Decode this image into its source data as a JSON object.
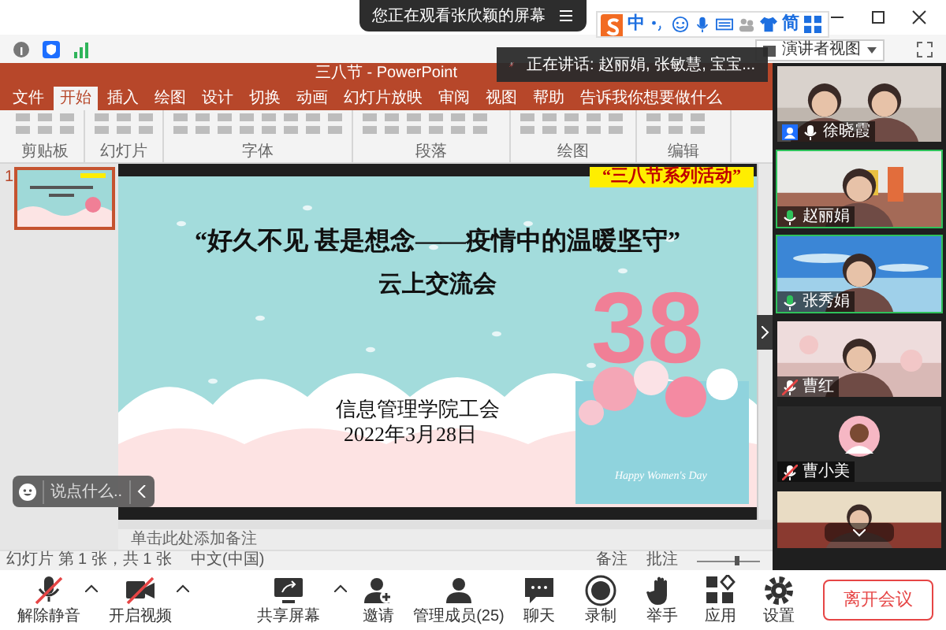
{
  "meeting_banner": {
    "text": "您正在观看张欣颖的屏幕"
  },
  "view_menu": {
    "label": "演讲者视图"
  },
  "ime_toolbar": {
    "items": [
      "中",
      "简"
    ]
  },
  "speaking_banner": {
    "text": "正在讲话: 赵丽娟, 张敏慧, 宝宝..."
  },
  "ppt": {
    "title": "三八节 - PowerPoint",
    "ribbon_tabs": [
      {
        "label": "文件",
        "selected": false
      },
      {
        "label": "开始",
        "selected": true
      },
      {
        "label": "插入",
        "selected": false
      },
      {
        "label": "绘图",
        "selected": false
      },
      {
        "label": "设计",
        "selected": false
      },
      {
        "label": "切换",
        "selected": false
      },
      {
        "label": "动画",
        "selected": false
      },
      {
        "label": "幻灯片放映",
        "selected": false
      },
      {
        "label": "审阅",
        "selected": false
      },
      {
        "label": "视图",
        "selected": false
      },
      {
        "label": "帮助",
        "selected": false
      },
      {
        "label": "告诉我你想要做什么",
        "selected": false
      }
    ],
    "ribbon_groups": [
      "剪贴板",
      "幻灯片",
      "字体",
      "段落",
      "绘图",
      "编辑"
    ],
    "thumbnails": [
      {
        "number": "1",
        "selected": true
      }
    ],
    "slide": {
      "banner": "“三八节系列活动”",
      "title": "“好久不见 甚是想念——疫情中的温暖坚守”",
      "subtitle": "云上交流会",
      "organizer": "信息管理学院工会",
      "date": "2022年3月28日",
      "big_number": "38",
      "card_text": "Happy Women's Day"
    },
    "notes_placeholder": "单击此处添加备注",
    "status_left": [
      "幻灯片 第 1 张，共 1 张",
      "中文(中国)"
    ],
    "status_right": [
      "备注",
      "批注"
    ],
    "zoom": {
      "level": 0.65
    }
  },
  "chat_input": {
    "placeholder": "说点什么..."
  },
  "participants": [
    {
      "name": "徐晓霞",
      "kind": "video",
      "muted": false,
      "speaking": false,
      "host": true
    },
    {
      "name": "赵丽娟",
      "kind": "video",
      "muted": false,
      "speaking": true,
      "host": false
    },
    {
      "name": "张秀娟",
      "kind": "video",
      "muted": false,
      "speaking": true,
      "host": false
    },
    {
      "name": "曹红",
      "kind": "video",
      "muted": true,
      "speaking": false,
      "host": false
    },
    {
      "name": "曹小美",
      "kind": "avatar",
      "muted": true,
      "speaking": false,
      "host": false
    },
    {
      "kind": "video"
    }
  ],
  "toolbar": [
    {
      "kind": "mic",
      "label": "解除静音",
      "off": true,
      "menu": true
    },
    {
      "kind": "video",
      "label": "开启视频",
      "off": true,
      "menu": true
    },
    {
      "kind": "share",
      "label": "共享屏幕",
      "off": false,
      "menu": true
    },
    {
      "kind": "invite",
      "label": "邀请",
      "off": false,
      "menu": false
    },
    {
      "kind": "members",
      "label": "管理成员(25)",
      "off": false,
      "menu": false
    },
    {
      "kind": "chat",
      "label": "聊天",
      "off": false,
      "menu": false
    },
    {
      "kind": "record",
      "label": "录制",
      "off": false,
      "menu": false
    },
    {
      "kind": "hand",
      "label": "举手",
      "off": false,
      "menu": false
    },
    {
      "kind": "apps",
      "label": "应用",
      "off": false,
      "menu": false
    },
    {
      "kind": "settings",
      "label": "设置",
      "off": false,
      "menu": false
    }
  ],
  "leave_button": {
    "label": "离开会议"
  }
}
